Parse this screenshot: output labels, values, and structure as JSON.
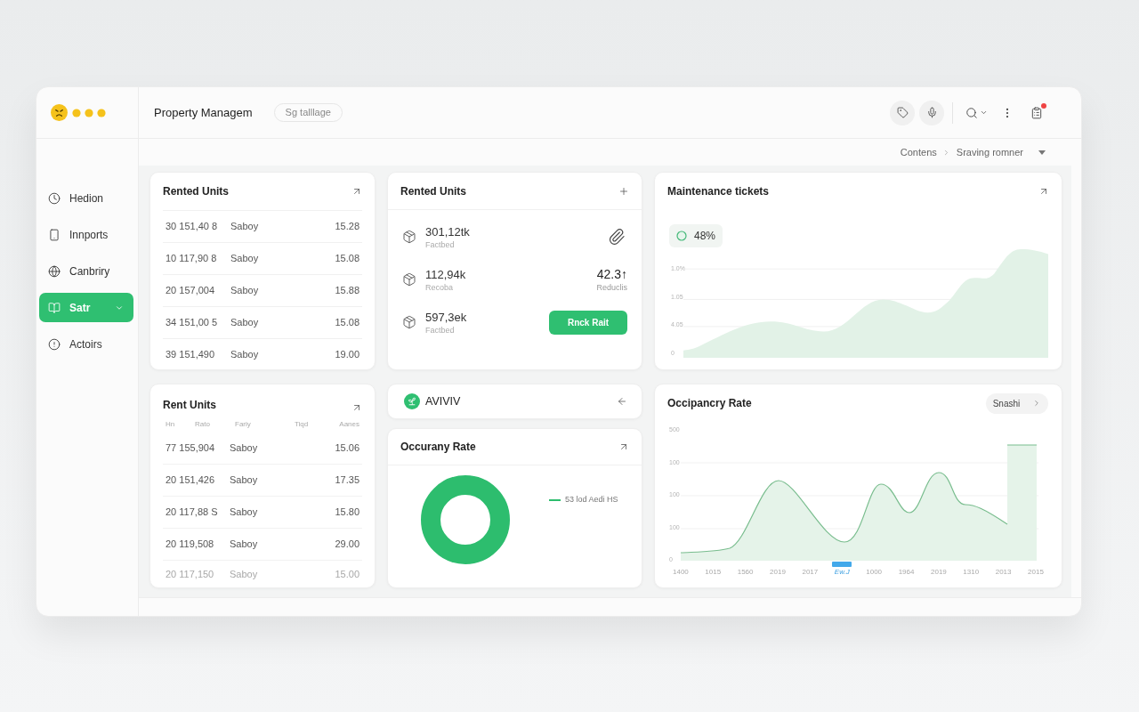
{
  "header": {
    "title": "Property Managem",
    "chip": "Sg talllage",
    "alert": true
  },
  "breadcrumb": [
    "Contens",
    "Sraving romner"
  ],
  "sidebar": {
    "items": [
      {
        "label": "Hedion",
        "selected": false
      },
      {
        "label": "Innports",
        "selected": false
      },
      {
        "label": "Canbriry",
        "selected": false
      },
      {
        "label": "Satr",
        "selected": true
      },
      {
        "label": "Actoirs",
        "selected": false
      }
    ]
  },
  "rented_units": {
    "title": "Rented Units",
    "rows": [
      {
        "id": "30 151,40 8",
        "name": "Saboy",
        "amount": "15.28"
      },
      {
        "id": "10 117,90 8",
        "name": "Saboy",
        "amount": "15.08"
      },
      {
        "id": "20 157,004",
        "name": "Saboy",
        "amount": "15.88"
      },
      {
        "id": "34 151,00 5",
        "name": "Saboy",
        "amount": "15.08"
      },
      {
        "id": "39 151,490",
        "name": "Saboy",
        "amount": "19.00"
      }
    ]
  },
  "unit_stats": {
    "title": "Rented Units",
    "rows": [
      {
        "kind": "attachment",
        "value": "301,12tk",
        "caption": "Factbed"
      },
      {
        "kind": "metric",
        "value": "112,94k",
        "caption": "Recoba",
        "metric": "42.3↑",
        "metric_caption": "Reduclis"
      },
      {
        "kind": "action",
        "value": "597,3ek",
        "caption": "Factbed",
        "button": "Rnck Rait"
      }
    ]
  },
  "maintenance": {
    "title": "Maintenance tickets",
    "badge": "48%",
    "y_labels": [
      "1.0%",
      "1.05",
      "4.05",
      "0"
    ]
  },
  "rent_units": {
    "title": "Rent Units",
    "columns": [
      "Hn",
      "Rato",
      "Fariy",
      "Tiqd",
      "Aanes"
    ],
    "rows": [
      {
        "id": "77 155,904",
        "name": "Saboy",
        "amount": "15.06",
        "faded": false
      },
      {
        "id": "20 151,426",
        "name": "Saboy",
        "amount": "17.35",
        "faded": false
      },
      {
        "id": "20 117,88 S",
        "name": "Saboy",
        "amount": "15.80",
        "faded": false
      },
      {
        "id": "20 119,508",
        "name": "Saboy",
        "amount": "29.00",
        "faded": false
      },
      {
        "id": "20 117,150",
        "name": "Saboy",
        "amount": "15.00",
        "faded": true
      }
    ]
  },
  "account": {
    "name": "AVIVIV"
  },
  "occupancy_donut": {
    "title": "Occurany Rate",
    "legend": "53 lod Aedi HS"
  },
  "occupancy_trend": {
    "title": "Occipancry Rate",
    "button": "Snashi",
    "y_labels": [
      "500",
      "100",
      "100",
      "100",
      "0"
    ],
    "x_labels": [
      {
        "label": "1400",
        "selected": false
      },
      {
        "label": "1015",
        "selected": false
      },
      {
        "label": "1560",
        "selected": false
      },
      {
        "label": "2019",
        "selected": false
      },
      {
        "label": "2017",
        "selected": false
      },
      {
        "label": "Ew.J",
        "selected": true
      },
      {
        "label": "1000",
        "selected": false
      },
      {
        "label": "1964",
        "selected": false
      },
      {
        "label": "2019",
        "selected": false
      },
      {
        "label": "1310",
        "selected": false
      },
      {
        "label": "2013",
        "selected": false
      },
      {
        "label": "2015",
        "selected": false
      }
    ]
  }
}
